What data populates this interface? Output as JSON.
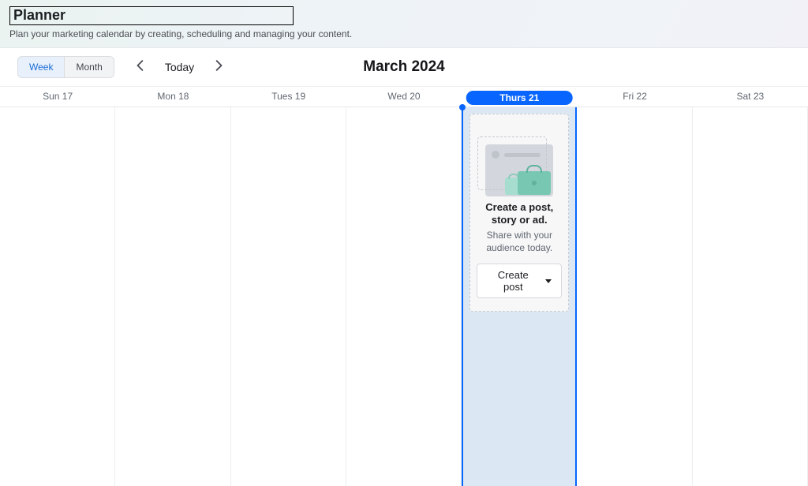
{
  "header": {
    "title": "Planner",
    "subtitle": "Plan your marketing calendar by creating, scheduling and managing your content."
  },
  "toolbar": {
    "view_week_label": "Week",
    "view_month_label": "Month",
    "active_view": "week",
    "today_label": "Today",
    "month_title": "March 2024"
  },
  "days": [
    {
      "label": "Sun 17",
      "is_today": false
    },
    {
      "label": "Mon 18",
      "is_today": false
    },
    {
      "label": "Tues 19",
      "is_today": false
    },
    {
      "label": "Wed 20",
      "is_today": false
    },
    {
      "label": "Thurs 21",
      "is_today": true
    },
    {
      "label": "Fri 22",
      "is_today": false
    },
    {
      "label": "Sat 23",
      "is_today": false
    }
  ],
  "create_card": {
    "title": "Create a post, story or ad.",
    "subtitle": "Share with your audience today.",
    "button_label": "Create post"
  },
  "colors": {
    "accent": "#0866ff",
    "today_bg": "#dbe7f3"
  }
}
